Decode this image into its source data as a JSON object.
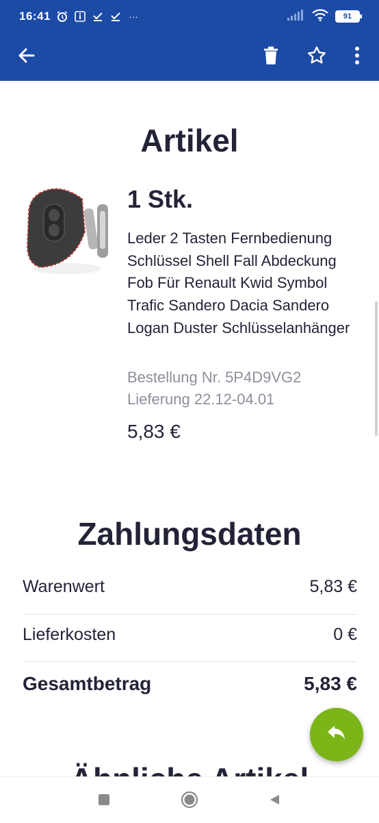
{
  "status_bar": {
    "time": "16:41",
    "battery": "91",
    "notifications": [
      "alarm-icon",
      "info-icon",
      "check-icon",
      "check-icon",
      "more-dots-icon"
    ],
    "more": "···"
  },
  "app_bar": {
    "icons": [
      "arrow-left-icon",
      "trash-icon",
      "star-outline-icon",
      "more-vert-icon"
    ],
    "color": "#1c4ba6"
  },
  "article": {
    "section_title": "Artikel",
    "quantity": "1 Stk.",
    "product_name": "Leder 2 Tasten Fernbedienung Schlüssel Shell Fall Abdeckung Fob Für Renault Kwid Symbol Trafic Sandero Dacia Sandero Logan Duster Schlüsselanhänger",
    "order_number": "Bestellung Nr. 5P4D9VG2",
    "delivery": "Lieferung 22.12-04.01",
    "price": "5,83 €"
  },
  "payment": {
    "section_title": "Zahlungsdaten",
    "rows": [
      {
        "label": "Warenwert",
        "value": "5,83 €"
      },
      {
        "label": "Lieferkosten",
        "value": "0 €"
      },
      {
        "label": "Gesamtbetrag",
        "value": "5,83 €"
      }
    ]
  },
  "similar": {
    "section_title": "Ähnliche Artikel"
  },
  "fab": {
    "icon": "reply-icon",
    "color": "#7cb518"
  },
  "nav_bar": {
    "icons": [
      "recents-square-icon",
      "home-circle-icon",
      "back-triangle-icon"
    ]
  }
}
